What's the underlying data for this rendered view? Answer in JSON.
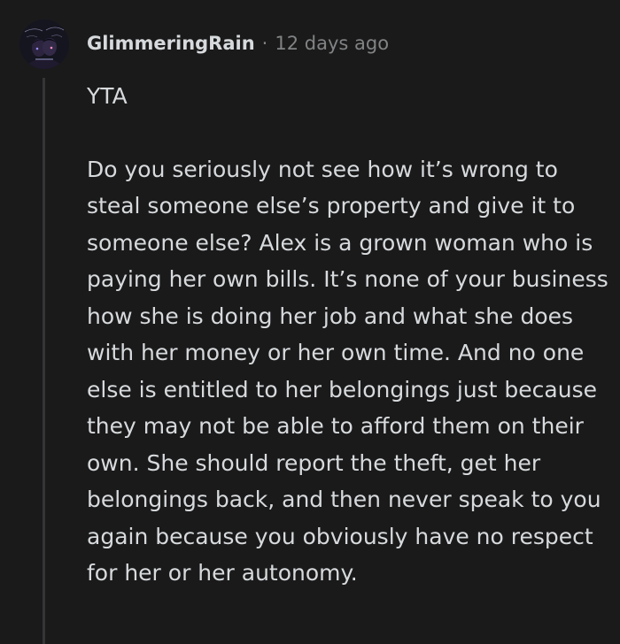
{
  "comment": {
    "author": "GlimmeringRain",
    "separator": "·",
    "timestamp": "12 days ago",
    "paragraphs": [
      "YTA",
      "Do you seriously not see how it’s wrong to steal someone else’s property and give it to someone else? Alex is a grown woman who is paying her own bills. It’s none of your business how she is doing her job and what she does with her money or her own time. And no one else is entitled to her belongings just because they may not be able to afford them on their own. She should report the theft, get her belongings back, and then never speak to you again because you obviously have no respect for her or her autonomy."
    ],
    "avatar_icon": "user-avatar-icon",
    "colors": {
      "background": "#1a1a1b",
      "text": "#d7dadc",
      "meta": "#818384",
      "thread_line": "#343536"
    }
  }
}
